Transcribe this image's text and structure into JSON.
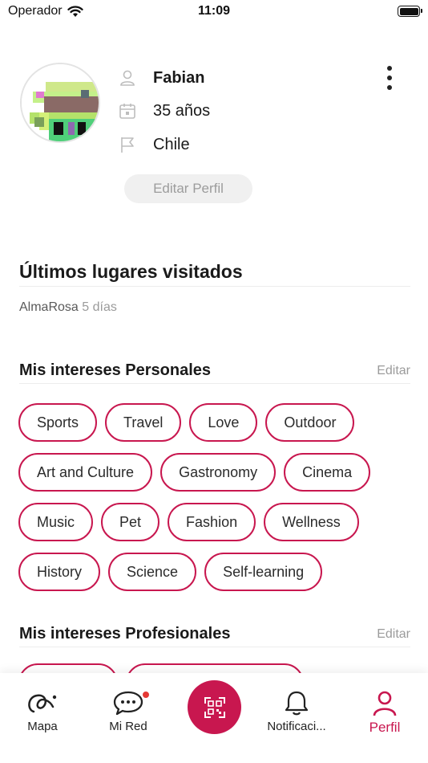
{
  "status_bar": {
    "carrier": "Operador",
    "time": "11:09"
  },
  "profile": {
    "name": "Fabian",
    "age": "35 años",
    "country": "Chile",
    "edit_button": "Editar Perfil"
  },
  "recent_places": {
    "title": "Últimos lugares visitados",
    "items": [
      {
        "place": "AlmaRosa",
        "ago": "5 días"
      }
    ]
  },
  "personal_interests": {
    "title": "Mis intereses Personales",
    "edit": "Editar",
    "chips": [
      "Sports",
      "Travel",
      "Love",
      "Outdoor",
      "Art and Culture",
      "Gastronomy",
      "Cinema",
      "Music",
      "Pet",
      "Fashion",
      "Wellness",
      "History",
      "Science",
      "Self-learning"
    ]
  },
  "professional_interests": {
    "title": "Mis intereses Profesionales",
    "edit": "Editar"
  },
  "tab_bar": {
    "tabs": [
      {
        "label": "Mapa",
        "icon": "map-logo-icon"
      },
      {
        "label": "Mi Red",
        "icon": "chat-bubble-icon"
      },
      {
        "label": "",
        "icon": "qr-code-icon"
      },
      {
        "label": "Notificaci...",
        "icon": "bell-icon"
      },
      {
        "label": "Perfil",
        "icon": "person-icon"
      }
    ],
    "active": "Perfil"
  },
  "colors": {
    "accent": "#c8174f",
    "muted": "#9b9b9b",
    "badge": "#e53935"
  }
}
